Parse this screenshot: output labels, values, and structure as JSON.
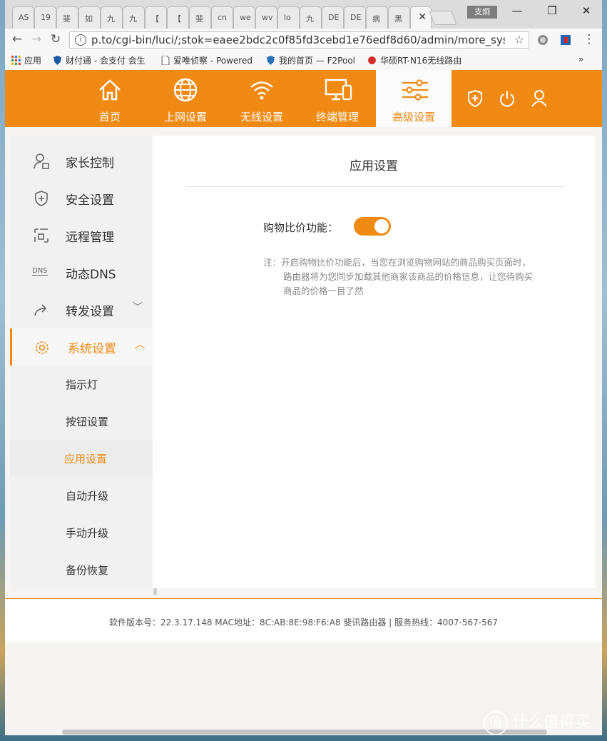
{
  "browser": {
    "tabs": [
      "AS",
      "19",
      "斐",
      "如",
      "九",
      "九",
      "【",
      "【",
      "斐",
      "cn",
      "we",
      "wv",
      "lo",
      "九",
      "DE",
      "DE",
      "病",
      "黑",
      ""
    ],
    "profile": "支炯",
    "url": "p.to/cgi-bin/luci/;stok=eaee2bdc2c0f85fd3cebd1e76edf8d60/admin/more_sysset/APPset",
    "bookmarks": [
      "应用",
      "财付通 - 会支付 会生",
      "爱唯侦察 - Powered",
      "我的首页 — F2Pool",
      "华硕RT-N16无线路由"
    ],
    "more": "»"
  },
  "nav": {
    "items": [
      {
        "label": "首页",
        "icon": "home-icon"
      },
      {
        "label": "上网设置",
        "icon": "globe-icon"
      },
      {
        "label": "无线设置",
        "icon": "wifi-icon"
      },
      {
        "label": "终端管理",
        "icon": "devices-icon"
      },
      {
        "label": "高级设置",
        "icon": "sliders-icon"
      }
    ],
    "right_icons": [
      "shield-icon",
      "power-icon",
      "user-icon"
    ]
  },
  "sidebar": {
    "items": [
      {
        "label": "家长控制",
        "icon": "parent-control-icon"
      },
      {
        "label": "安全设置",
        "icon": "shield-icon"
      },
      {
        "label": "远程管理",
        "icon": "remote-icon"
      },
      {
        "label": "动态DNS",
        "icon": "dns-icon"
      },
      {
        "label": "转发设置",
        "icon": "forward-icon"
      },
      {
        "label": "系统设置",
        "icon": "gear-icon"
      }
    ],
    "dns_icon_text": "DNS",
    "chevron_down": "﹀",
    "chevron_up": "︿",
    "subitems": [
      "指示灯",
      "按钮设置",
      "应用设置",
      "自动升级",
      "手动升级",
      "备份恢复"
    ]
  },
  "content": {
    "title": "应用设置",
    "option_label": "购物比价功能：",
    "toggle_on": true,
    "note_lines": [
      "注：开启购物比价功能后，当您在浏览购物网站的商品购买页面时，",
      "路由器将为您同步加载其他商家该商品的价格信息，让您待购买",
      "商品的价格一目了然"
    ]
  },
  "footer": {
    "text": "软件版本号：22.3.17.148    MAC地址：8C:AB:8E:98:F6:A8    斐讯路由器 | 服务热线：4007-567-567"
  },
  "watermark": {
    "badge": "值",
    "text": "什么值得买"
  },
  "colors": {
    "accent": "#f08a12"
  }
}
